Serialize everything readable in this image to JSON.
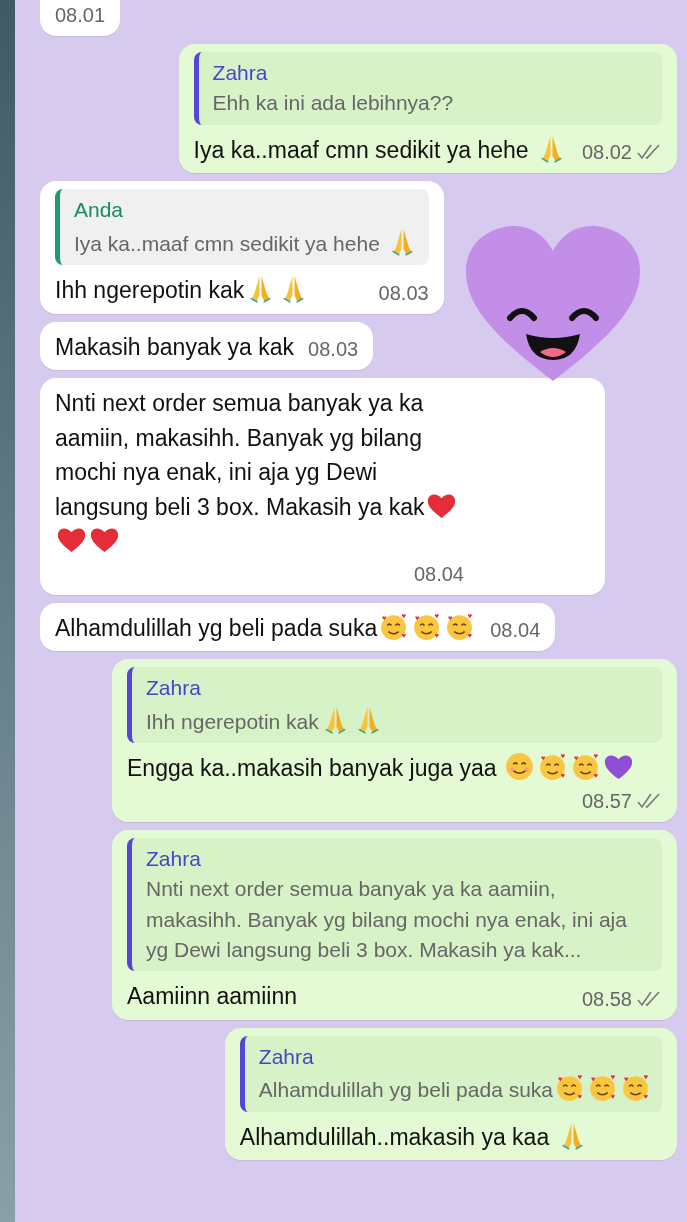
{
  "messages": [
    {
      "kind": "text",
      "outgoing": false,
      "time": "08.01",
      "cut_top": true
    },
    {
      "kind": "text",
      "outgoing": true,
      "quote": {
        "author": "Zahra",
        "self": false,
        "text": "Ehh ka ini ada lebihnya??"
      },
      "text": "Iya ka..maaf cmn sedikit ya hehe ",
      "emoji": [
        {
          "kind": "pray"
        }
      ],
      "time": "08.02",
      "delivered": true
    },
    {
      "kind": "text",
      "outgoing": false,
      "quote": {
        "author": "Anda",
        "self": true,
        "text": "Iya ka..maaf cmn sedikit ya hehe ",
        "emoji": [
          {
            "kind": "pray"
          }
        ]
      },
      "text": "Ihh ngerepotin kak",
      "emoji": [
        {
          "kind": "pray"
        },
        {
          "kind": "pray"
        }
      ],
      "time": "08.03"
    },
    {
      "kind": "sticker"
    },
    {
      "kind": "text",
      "outgoing": false,
      "text": "Makasih banyak ya kak",
      "time": "08.03"
    },
    {
      "kind": "text",
      "outgoing": false,
      "text": "Nnti next order semua banyak ya ka aamiin, makasihh. Banyak yg bilang mochi nya enak, ini aja yg Dewi langsung beli 3 box. Makasih ya kak",
      "emoji": [
        {
          "kind": "heart"
        },
        {
          "kind": "heart"
        },
        {
          "kind": "heart"
        }
      ],
      "time": "08.04"
    },
    {
      "kind": "text",
      "outgoing": false,
      "text": "Alhamdulillah yg beli pada suka",
      "emoji": [
        {
          "kind": "hearts-face"
        },
        {
          "kind": "hearts-face"
        },
        {
          "kind": "hearts-face"
        }
      ],
      "time": "08.04"
    },
    {
      "kind": "text",
      "outgoing": true,
      "quote": {
        "author": "Zahra",
        "self": false,
        "text": "Ihh ngerepotin kak",
        "emoji": [
          {
            "kind": "pray"
          },
          {
            "kind": "pray"
          }
        ]
      },
      "text": "Engga ka..makasih banyak juga yaa ",
      "emoji": [
        {
          "kind": "smile"
        },
        {
          "kind": "hearts-face"
        },
        {
          "kind": "hearts-face"
        },
        {
          "kind": "purple-heart"
        }
      ],
      "time": "08.57",
      "delivered": true
    },
    {
      "kind": "text",
      "outgoing": true,
      "quote": {
        "author": "Zahra",
        "self": false,
        "text": "Nnti next order semua banyak ya ka aamiin, makasihh. Banyak yg bilang mochi nya enak, ini aja yg Dewi langsung beli 3 box. Makasih ya kak..."
      },
      "text": "Aamiinn aamiinn",
      "time": "08.58",
      "delivered": true
    },
    {
      "kind": "text",
      "outgoing": true,
      "quote": {
        "author": "Zahra",
        "self": false,
        "text": "Alhamdulillah yg beli pada suka",
        "emoji": [
          {
            "kind": "hearts-face"
          },
          {
            "kind": "hearts-face"
          },
          {
            "kind": "hearts-face"
          }
        ]
      },
      "text": "Alhamdulillah..makasih ya kaa ",
      "emoji": [
        {
          "kind": "pray"
        }
      ]
    }
  ]
}
